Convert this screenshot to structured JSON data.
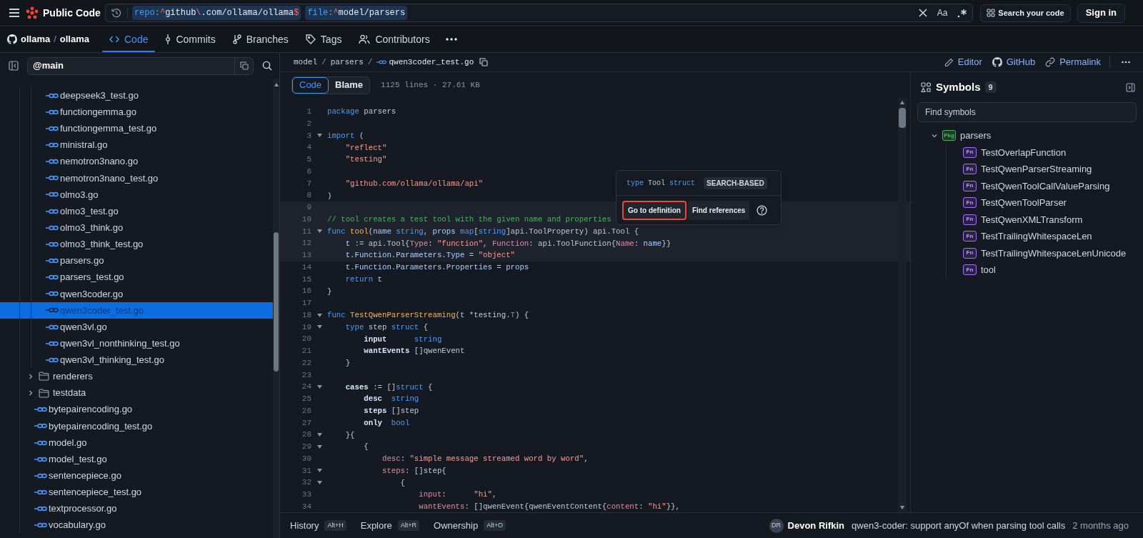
{
  "top_bar": {
    "brand": "Public Code",
    "query": [
      [
        {
          "kind": "key",
          "text": "repo"
        },
        {
          "kind": "sep",
          "text": ":"
        },
        {
          "kind": "op",
          "text": "^"
        },
        {
          "kind": "val",
          "text": "github"
        },
        {
          "kind": "op",
          "text": "\\"
        },
        {
          "kind": "val",
          "text": ".com/ollama/ollama"
        },
        {
          "kind": "op",
          "text": "$"
        }
      ],
      [
        {
          "kind": "key",
          "text": "file"
        },
        {
          "kind": "sep",
          "text": ":"
        },
        {
          "kind": "op",
          "text": "^"
        },
        {
          "kind": "val",
          "text": "model/parsers"
        }
      ]
    ],
    "case_toggle": "Aa",
    "search_button": "Search your code",
    "sign_in": "Sign in"
  },
  "repo_nav": {
    "owner": "ollama",
    "separator": "/",
    "repo": "ollama",
    "tabs": [
      {
        "label": "Code",
        "selected": true
      },
      {
        "label": "Commits",
        "selected": false
      },
      {
        "label": "Branches",
        "selected": false
      },
      {
        "label": "Tags",
        "selected": false
      },
      {
        "label": "Contributors",
        "selected": false
      }
    ]
  },
  "file_tree": {
    "branch": "@main",
    "items": [
      {
        "kind": "group",
        "children": [
          {
            "kind": "file",
            "name": "deepseek3_test.go",
            "selected": false
          },
          {
            "kind": "file",
            "name": "functiongemma.go",
            "selected": false
          },
          {
            "kind": "file",
            "name": "functiongemma_test.go",
            "selected": false
          },
          {
            "kind": "file",
            "name": "ministral.go",
            "selected": false
          },
          {
            "kind": "file",
            "name": "nemotron3nano.go",
            "selected": false
          },
          {
            "kind": "file",
            "name": "nemotron3nano_test.go",
            "selected": false
          },
          {
            "kind": "file",
            "name": "olmo3.go",
            "selected": false
          },
          {
            "kind": "file",
            "name": "olmo3_test.go",
            "selected": false
          },
          {
            "kind": "file",
            "name": "olmo3_think.go",
            "selected": false
          },
          {
            "kind": "file",
            "name": "olmo3_think_test.go",
            "selected": false
          },
          {
            "kind": "file",
            "name": "parsers.go",
            "selected": false
          },
          {
            "kind": "file",
            "name": "parsers_test.go",
            "selected": false
          },
          {
            "kind": "file",
            "name": "qwen3coder.go",
            "selected": false
          },
          {
            "kind": "file",
            "name": "qwen3coder_test.go",
            "selected": true
          },
          {
            "kind": "file",
            "name": "qwen3vl.go",
            "selected": false
          },
          {
            "kind": "file",
            "name": "qwen3vl_nonthinking_test.go",
            "selected": false
          },
          {
            "kind": "file",
            "name": "qwen3vl_thinking_test.go",
            "selected": false
          }
        ]
      },
      {
        "kind": "folder",
        "name": "renderers",
        "expanded": false,
        "selected": false
      },
      {
        "kind": "folder",
        "name": "testdata",
        "expanded": false,
        "selected": false
      },
      {
        "kind": "file",
        "name": "bytepairencoding.go",
        "selected": false
      },
      {
        "kind": "file",
        "name": "bytepairencoding_test.go",
        "selected": false
      },
      {
        "kind": "file",
        "name": "model.go",
        "selected": false
      },
      {
        "kind": "file",
        "name": "model_test.go",
        "selected": false
      },
      {
        "kind": "file",
        "name": "sentencepiece.go",
        "selected": false
      },
      {
        "kind": "file",
        "name": "sentencepiece_test.go",
        "selected": false
      },
      {
        "kind": "file",
        "name": "textprocessor.go",
        "selected": false
      },
      {
        "kind": "file",
        "name": "vocabulary.go",
        "selected": false
      }
    ]
  },
  "file_header": {
    "breadcrumb": [
      {
        "kind": "dir",
        "text": "model"
      },
      {
        "kind": "sep",
        "text": "/"
      },
      {
        "kind": "dir",
        "text": "parsers"
      },
      {
        "kind": "sep",
        "text": "/"
      },
      {
        "kind": "file",
        "text": "qwen3coder_test.go"
      }
    ],
    "actions": [
      "Editor",
      "GitHub",
      "Permalink"
    ]
  },
  "view_tabs": [
    {
      "label": "Code",
      "selected": true
    },
    {
      "label": "Blame",
      "selected": false
    }
  ],
  "file_info": "1125 lines · 27.61 KB",
  "code_lines": [
    {
      "number": "1",
      "fold": false,
      "highlighted": false,
      "tokens": [
        {
          "kind": "keyword",
          "text": "package"
        },
        {
          "kind": "plain",
          "text": " parsers"
        }
      ]
    },
    {
      "number": "2",
      "fold": false,
      "highlighted": false
    },
    {
      "number": "3",
      "fold": true,
      "highlighted": false,
      "tokens": [
        {
          "kind": "keyword",
          "text": "import"
        },
        {
          "kind": "plain",
          "text": " ("
        }
      ]
    },
    {
      "number": "4",
      "fold": false,
      "highlighted": false,
      "tokens": [
        {
          "kind": "string",
          "text": "    \"reflect\""
        }
      ]
    },
    {
      "number": "5",
      "fold": false,
      "highlighted": false,
      "tokens": [
        {
          "kind": "string",
          "text": "    \"testing\""
        }
      ]
    },
    {
      "number": "6",
      "fold": false,
      "highlighted": false
    },
    {
      "number": "7",
      "fold": false,
      "highlighted": false,
      "tokens": [
        {
          "kind": "string",
          "text": "    \"github.com/ollama/ollama/api\""
        }
      ]
    },
    {
      "number": "8",
      "fold": false,
      "highlighted": false,
      "tokens": [
        {
          "kind": "plain",
          "text": ")"
        }
      ]
    },
    {
      "number": "9",
      "fold": false,
      "highlighted": true
    },
    {
      "number": "10",
      "fold": false,
      "highlighted": true,
      "tokens": [
        {
          "kind": "comment",
          "text": "// tool creates a test tool with the given name and properties"
        }
      ]
    },
    {
      "number": "11",
      "fold": true,
      "highlighted": true,
      "tokens": [
        {
          "kind": "keyword",
          "text": "func"
        },
        {
          "kind": "function",
          "text": " tool"
        },
        {
          "kind": "plain",
          "text": "("
        },
        {
          "kind": "ident",
          "text": "name"
        },
        {
          "kind": "keyword",
          "text": " string"
        },
        {
          "kind": "plain",
          "text": ", "
        },
        {
          "kind": "ident",
          "text": "props"
        },
        {
          "kind": "keyword",
          "text": " map"
        },
        {
          "kind": "plain",
          "text": "["
        },
        {
          "kind": "keyword",
          "text": "string"
        },
        {
          "kind": "plain",
          "text": "]api.ToolProperty) api.Tool {"
        }
      ]
    },
    {
      "number": "12",
      "fold": false,
      "highlighted": true,
      "tokens": [
        {
          "kind": "ident",
          "text": "    t"
        },
        {
          "kind": "plain",
          "text": " := api.Tool{"
        },
        {
          "kind": "key",
          "text": "Type"
        },
        {
          "kind": "plain",
          "text": ": "
        },
        {
          "kind": "string",
          "text": "\"function\""
        },
        {
          "kind": "plain",
          "text": ", "
        },
        {
          "kind": "key",
          "text": "Function"
        },
        {
          "kind": "plain",
          "text": ": api.ToolFunction{"
        },
        {
          "kind": "key",
          "text": "Name"
        },
        {
          "kind": "plain",
          "text": ": "
        },
        {
          "kind": "ident",
          "text": "name"
        },
        {
          "kind": "plain",
          "text": "}}"
        }
      ]
    },
    {
      "number": "13",
      "fold": false,
      "highlighted": true,
      "tokens": [
        {
          "kind": "ident",
          "text": "    t.Function.Parameters.Type"
        },
        {
          "kind": "plain",
          "text": " = "
        },
        {
          "kind": "string",
          "text": "\"object\""
        }
      ]
    },
    {
      "number": "14",
      "fold": false,
      "highlighted": false,
      "tokens": [
        {
          "kind": "ident",
          "text": "    t.Function.Parameters.Properties"
        },
        {
          "kind": "plain",
          "text": " = "
        },
        {
          "kind": "ident",
          "text": "props"
        }
      ]
    },
    {
      "number": "15",
      "fold": false,
      "highlighted": false,
      "tokens": [
        {
          "kind": "keyword",
          "text": "    return"
        },
        {
          "kind": "ident",
          "text": " t"
        }
      ]
    },
    {
      "number": "16",
      "fold": false,
      "highlighted": false,
      "tokens": [
        {
          "kind": "plain",
          "text": "}"
        }
      ]
    },
    {
      "number": "17",
      "fold": false,
      "highlighted": false
    },
    {
      "number": "18",
      "fold": true,
      "highlighted": false,
      "tokens": [
        {
          "kind": "keyword",
          "text": "func"
        },
        {
          "kind": "function",
          "text": " TestQwenParserStreaming"
        },
        {
          "kind": "plain",
          "text": "("
        },
        {
          "kind": "ident",
          "text": "t"
        },
        {
          "kind": "plain",
          "text": " *testing."
        },
        {
          "kind": "keyword",
          "text": "T"
        },
        {
          "kind": "plain",
          "text": ") {"
        }
      ]
    },
    {
      "number": "19",
      "fold": true,
      "highlighted": false,
      "tokens": [
        {
          "kind": "keyword",
          "text": "    type"
        },
        {
          "kind": "plain",
          "text": " step "
        },
        {
          "kind": "keyword",
          "text": "struct"
        },
        {
          "kind": "plain",
          "text": " {"
        }
      ]
    },
    {
      "number": "20",
      "fold": false,
      "highlighted": false,
      "tokens": [
        {
          "kind": "field",
          "text": "        input"
        },
        {
          "kind": "keyword",
          "text": "      string"
        }
      ]
    },
    {
      "number": "21",
      "fold": false,
      "highlighted": false,
      "tokens": [
        {
          "kind": "field",
          "text": "        wantEvents"
        },
        {
          "kind": "plain",
          "text": " []qwenEvent"
        }
      ]
    },
    {
      "number": "22",
      "fold": false,
      "highlighted": false,
      "tokens": [
        {
          "kind": "plain",
          "text": "    }"
        }
      ]
    },
    {
      "number": "23",
      "fold": false,
      "highlighted": false
    },
    {
      "number": "24",
      "fold": true,
      "highlighted": false,
      "tokens": [
        {
          "kind": "field",
          "text": "    cases"
        },
        {
          "kind": "plain",
          "text": " := []"
        },
        {
          "kind": "keyword",
          "text": "struct"
        },
        {
          "kind": "plain",
          "text": " {"
        }
      ]
    },
    {
      "number": "25",
      "fold": false,
      "highlighted": false,
      "tokens": [
        {
          "kind": "field",
          "text": "        desc"
        },
        {
          "kind": "keyword",
          "text": "  string"
        }
      ]
    },
    {
      "number": "26",
      "fold": false,
      "highlighted": false,
      "tokens": [
        {
          "kind": "field",
          "text": "        steps"
        },
        {
          "kind": "plain",
          "text": " []step"
        }
      ]
    },
    {
      "number": "27",
      "fold": false,
      "highlighted": false,
      "tokens": [
        {
          "kind": "field",
          "text": "        only"
        },
        {
          "kind": "keyword",
          "text": "  bool"
        }
      ]
    },
    {
      "number": "28",
      "fold": true,
      "highlighted": false,
      "tokens": [
        {
          "kind": "plain",
          "text": "    }{"
        }
      ]
    },
    {
      "number": "29",
      "fold": true,
      "highlighted": false,
      "tokens": [
        {
          "kind": "plain",
          "text": "        {"
        }
      ]
    },
    {
      "number": "30",
      "fold": false,
      "highlighted": false,
      "tokens": [
        {
          "kind": "key",
          "text": "            desc"
        },
        {
          "kind": "plain",
          "text": ": "
        },
        {
          "kind": "string",
          "text": "\"simple message streamed word by word\""
        },
        {
          "kind": "plain",
          "text": ","
        }
      ]
    },
    {
      "number": "31",
      "fold": true,
      "highlighted": false,
      "tokens": [
        {
          "kind": "key",
          "text": "            steps"
        },
        {
          "kind": "plain",
          "text": ": []step{"
        }
      ]
    },
    {
      "number": "32",
      "fold": true,
      "highlighted": false,
      "tokens": [
        {
          "kind": "plain",
          "text": "                {"
        }
      ]
    },
    {
      "number": "33",
      "fold": false,
      "highlighted": false,
      "tokens": [
        {
          "kind": "key",
          "text": "                    input"
        },
        {
          "kind": "plain",
          "text": ":      "
        },
        {
          "kind": "string",
          "text": "\"hi\""
        },
        {
          "kind": "plain",
          "text": ","
        }
      ]
    },
    {
      "number": "34",
      "fold": false,
      "highlighted": false,
      "tokens": [
        {
          "kind": "key",
          "text": "                    wantEvents"
        },
        {
          "kind": "plain",
          "text": ": []qwenEvent{qwenEventContent{"
        },
        {
          "kind": "key",
          "text": "content"
        },
        {
          "kind": "plain",
          "text": ": "
        },
        {
          "kind": "string",
          "text": "\"hi\""
        },
        {
          "kind": "plain",
          "text": "}},"
        }
      ]
    }
  ],
  "popover": {
    "signature": [
      {
        "kind": "keyword",
        "text": "type"
      },
      {
        "kind": "plain",
        "text": " Tool "
      },
      {
        "kind": "keyword",
        "text": "struct"
      }
    ],
    "badge": "SEARCH-BASED",
    "buttons": [
      {
        "label": "Go to definition",
        "highlighted": true
      },
      {
        "label": "Find references",
        "highlighted": false
      }
    ]
  },
  "symbols": {
    "title": "Symbols",
    "count": "9",
    "search": {
      "placeholder": "Find symbols"
    },
    "tree": [
      {
        "kind": "package",
        "tag": "Pkg",
        "name": "parsers",
        "expanded": true,
        "children": [
          {
            "kind": "function",
            "tag": "Fn",
            "name": "TestOverlapFunction"
          },
          {
            "kind": "function",
            "tag": "Fn",
            "name": "TestQwenParserStreaming"
          },
          {
            "kind": "function",
            "tag": "Fn",
            "name": "TestQwenToolCallValueParsing"
          },
          {
            "kind": "function",
            "tag": "Fn",
            "name": "TestQwenToolParser"
          },
          {
            "kind": "function",
            "tag": "Fn",
            "name": "TestQwenXMLTransform"
          },
          {
            "kind": "function",
            "tag": "Fn",
            "name": "TestTrailingWhitespaceLen"
          },
          {
            "kind": "function",
            "tag": "Fn",
            "name": "TestTrailingWhitespaceLenUnicode"
          },
          {
            "kind": "function",
            "tag": "Fn",
            "name": "tool"
          }
        ]
      }
    ]
  },
  "bottom_bar": {
    "tabs": [
      {
        "label": "History",
        "shortcut": "Alt+H"
      },
      {
        "label": "Explore",
        "shortcut": "Alt+R"
      },
      {
        "label": "Ownership",
        "shortcut": "Alt+O"
      }
    ],
    "author_initials": "DR",
    "author": "Devon Rifkin",
    "message": "qwen3-coder: support anyOf when parsing tool calls",
    "time": "2 months ago"
  }
}
